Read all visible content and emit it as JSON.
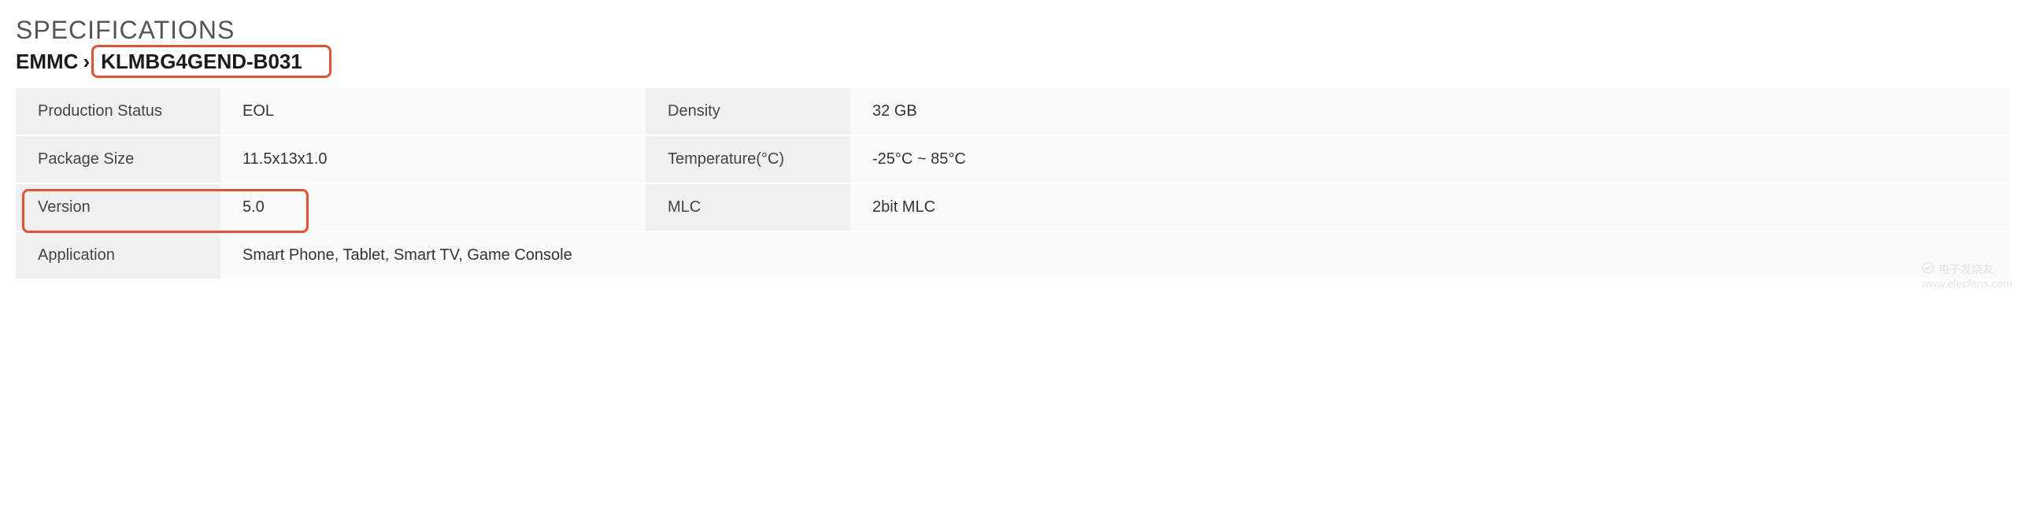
{
  "title": "SPECIFICATIONS",
  "breadcrumb": {
    "parent": "EMMC",
    "separator": "›",
    "current": "KLMBG4GEND-B031"
  },
  "specs": {
    "rows": [
      {
        "label1": "Production Status",
        "value1": "EOL",
        "label2": "Density",
        "value2": "32 GB"
      },
      {
        "label1": "Package Size",
        "value1": "11.5x13x1.0",
        "label2": "Temperature(°C)",
        "value2": "-25°C ~ 85°C"
      },
      {
        "label1": "Version",
        "value1": "5.0",
        "label2": "MLC",
        "value2": "2bit MLC"
      }
    ],
    "appRow": {
      "label": "Application",
      "value": "Smart Phone, Tablet, Smart TV, Game Console"
    }
  },
  "watermark": {
    "text": "电子发烧友",
    "url": "www.elecfans.com"
  }
}
